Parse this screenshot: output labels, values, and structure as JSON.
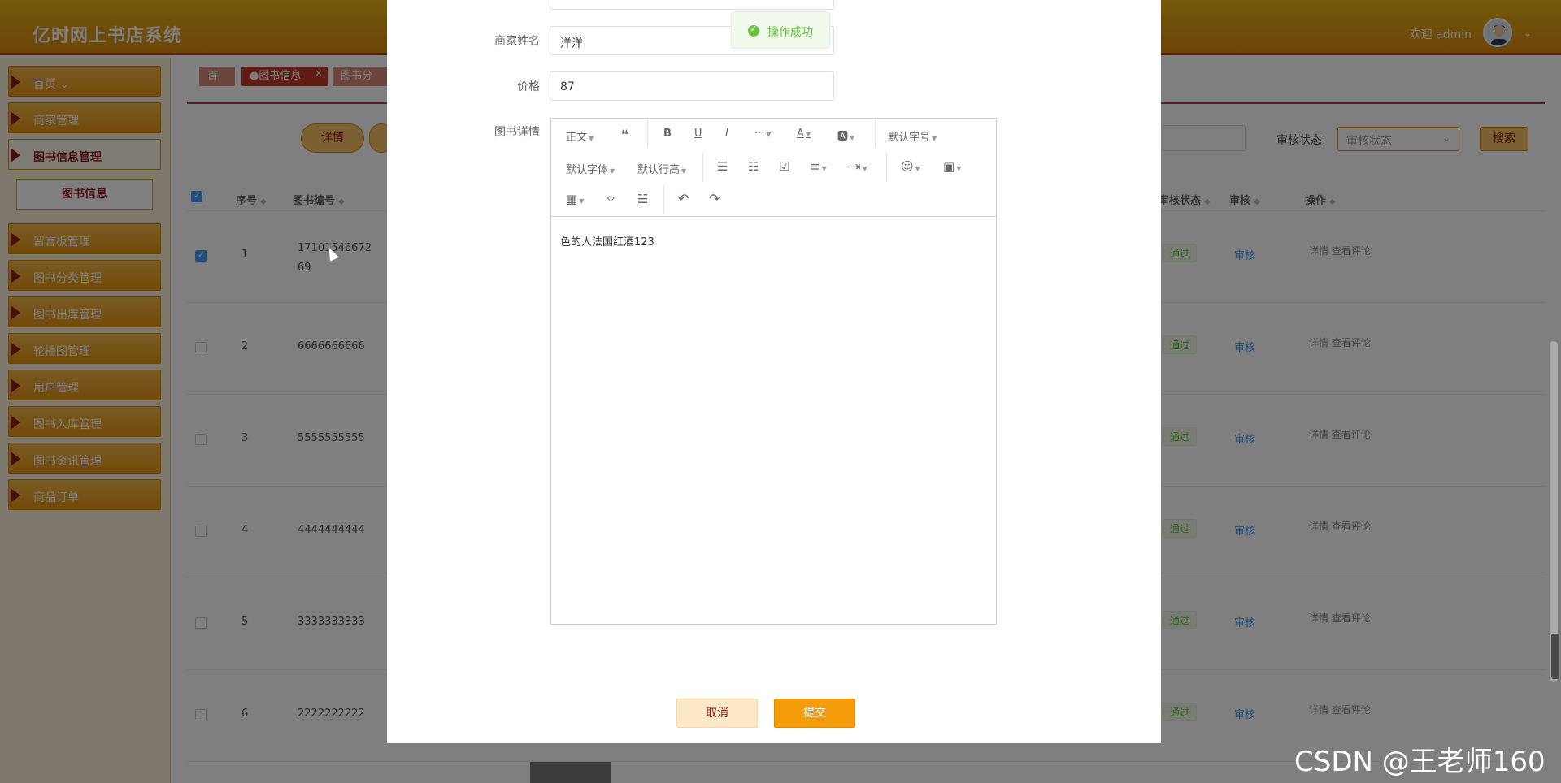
{
  "header": {
    "brand": "亿时网上书店系统",
    "welcome": "欢迎 admin"
  },
  "sidebar": {
    "items": [
      {
        "label": "首页 ⌄"
      },
      {
        "label": "商家管理"
      },
      {
        "label": "图书信息管理"
      },
      {
        "label": "留言板管理"
      },
      {
        "label": "图书分类管理"
      },
      {
        "label": "图书出库管理"
      },
      {
        "label": "轮播图管理"
      },
      {
        "label": "用户管理"
      },
      {
        "label": "图书入库管理"
      },
      {
        "label": "图书资讯管理"
      },
      {
        "label": "商品订单"
      }
    ],
    "submenu_item": "图书信息"
  },
  "tabs": [
    {
      "label": "首页"
    },
    {
      "label": "●图书信息"
    },
    {
      "label": "图书分类"
    }
  ],
  "tabs_close": "×",
  "toolbar": {
    "detail_button": "详情",
    "audit_label": "审核状态:",
    "audit_placeholder": "审核状态",
    "search_button": "搜索"
  },
  "table": {
    "headers": {
      "seq": "序号",
      "code": "图书编号",
      "audit_status": "审核状态",
      "audit": "审核",
      "ops": "操作"
    },
    "rows": [
      {
        "seq": "1",
        "code": "17101546672\n69",
        "status": "通过",
        "audit": "审核",
        "ops": "详情 查看评论",
        "checked": true
      },
      {
        "seq": "2",
        "code": "6666666666",
        "status": "通过",
        "audit": "审核",
        "ops": "详情 查看评论",
        "checked": false
      },
      {
        "seq": "3",
        "code": "5555555555",
        "status": "通过",
        "audit": "审核",
        "ops": "详情 查看评论",
        "checked": false
      },
      {
        "seq": "4",
        "code": "4444444444",
        "status": "通过",
        "audit": "审核",
        "ops": "详情 查看评论",
        "checked": false
      },
      {
        "seq": "5",
        "code": "3333333333",
        "status": "通过",
        "audit": "审核",
        "ops": "详情 查看评论",
        "checked": false
      },
      {
        "seq": "6",
        "code": "2222222222",
        "status": "通过",
        "audit": "审核",
        "ops": "详情 查看评论",
        "checked": false
      }
    ]
  },
  "dialog": {
    "merchant_name_label": "商家姓名",
    "merchant_name_value": "洋洋",
    "price_label": "价格",
    "price_value": "87",
    "detail_label": "图书详情",
    "editor": {
      "paragraph": "正文",
      "font_size": "默认字号",
      "font_family": "默认字体",
      "line_height": "默认行高",
      "content": "色的人法国红酒123"
    },
    "cancel": "取消",
    "submit": "提交"
  },
  "toast": "操作成功",
  "watermark": "CSDN @王老师160",
  "colors": {
    "primary": "#f59c0a",
    "header": "#d88a0b",
    "accent_red": "#8e1c1c",
    "success": "#67c23a",
    "link": "#409eff"
  }
}
